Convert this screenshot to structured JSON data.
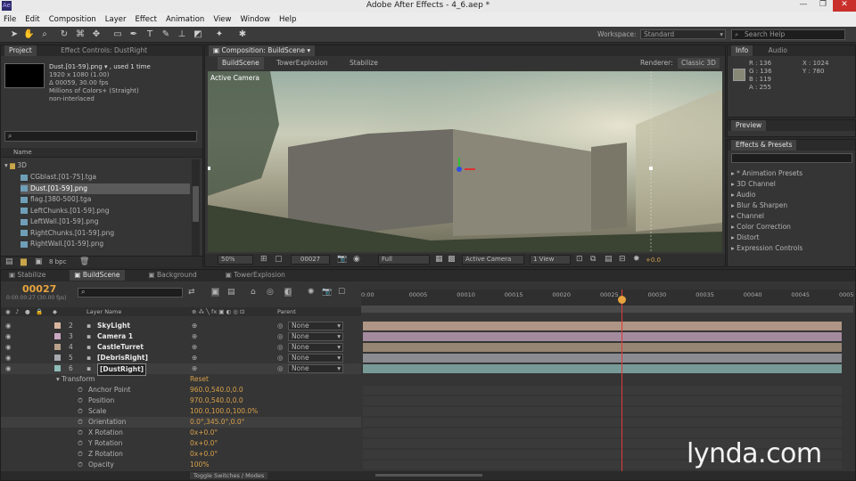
{
  "app": {
    "title": "Adobe After Effects - 4_6.aep *"
  },
  "menu": [
    "File",
    "Edit",
    "Composition",
    "Layer",
    "Effect",
    "Animation",
    "View",
    "Window",
    "Help"
  ],
  "workspace": {
    "label": "Workspace:",
    "value": "Standard"
  },
  "search_help": "Search Help",
  "project": {
    "tabs": [
      "Project",
      "Effect Controls: DustRight"
    ],
    "info_name": "Dust.[01-59].png ▾ , used 1 time",
    "info_lines": [
      "1920 x 1080 (1.00)",
      "Δ 00059, 30.00 fps",
      "Millions of Colors+ (Straight)",
      "non-interlaced"
    ],
    "col_name": "Name",
    "folder": "3D",
    "items": [
      "CGblast.[01-75].tga",
      "Dust.[01-59].png",
      "flag.[380-500].tga",
      "LeftChunks.[01-59].png",
      "LeftWall.[01-59].png",
      "RightChunks.[01-59].png",
      "RightWall.[01-59].png"
    ],
    "bpc": "8 bpc"
  },
  "comp": {
    "tab": "Composition: BuildScene",
    "breadcrumbs": [
      "BuildScene",
      "TowerExplosion",
      "Stabilize"
    ],
    "renderer_label": "Renderer:",
    "renderer": "Classic 3D",
    "camera_label": "Active Camera",
    "zoom": "50%",
    "timecode": "00027",
    "quality": "Full",
    "view_camera": "Active Camera",
    "views": "1 View",
    "exposure": "+0.0"
  },
  "info": {
    "tabs": [
      "Info",
      "Audio"
    ],
    "r": "R : 136",
    "g": "G : 136",
    "b": "B : 119",
    "a": "A : 255",
    "x": "X : 1024",
    "y": "Y : 780"
  },
  "preview": {
    "tab": "Preview"
  },
  "effects": {
    "tab": "Effects & Presets",
    "items": [
      "* Animation Presets",
      "3D Channel",
      "Audio",
      "Blur & Sharpen",
      "Channel",
      "Color Correction",
      "Distort",
      "Expression Controls"
    ]
  },
  "timeline": {
    "tabs": [
      "Stabilize",
      "BuildScene",
      "Background",
      "TowerExplosion"
    ],
    "current_time": "00027",
    "time_sub": "0:00:00:27 (30.00 fps)",
    "col_layer": "Layer Name",
    "col_parent": "Parent",
    "ruler": [
      "0:00",
      "00005",
      "00010",
      "00015",
      "00020",
      "00025",
      "00030",
      "00035",
      "00040",
      "00045",
      "0005"
    ],
    "layers": [
      {
        "num": "2",
        "name": "SkyLight",
        "parent": "None",
        "color": "#d8b5a0"
      },
      {
        "num": "3",
        "name": "Camera 1",
        "parent": "None",
        "color": "#c8a8c0"
      },
      {
        "num": "4",
        "name": "CastleTurret",
        "parent": "None",
        "color": "#b8a28a"
      },
      {
        "num": "5",
        "name": "[DebrisRight]",
        "parent": "None",
        "color": "#a8aab0"
      },
      {
        "num": "6",
        "name": "[DustRight]",
        "parent": "None",
        "color": "#8fbcb8"
      }
    ],
    "transform_label": "Transform",
    "reset": "Reset",
    "props": [
      {
        "name": "Anchor Point",
        "value": "960.0,540.0,0.0"
      },
      {
        "name": "Position",
        "value": "970.0,540.0,0.0"
      },
      {
        "name": "Scale",
        "value": "100.0,100.0,100.0%"
      },
      {
        "name": "Orientation",
        "value": "0.0°,345.0°,0.0°"
      },
      {
        "name": "X Rotation",
        "value": "0x+0.0°"
      },
      {
        "name": "Y Rotation",
        "value": "0x+0.0°"
      },
      {
        "name": "Z Rotation",
        "value": "0x+0.0°"
      },
      {
        "name": "Opacity",
        "value": "100%"
      }
    ],
    "toggle": "Toggle Switches / Modes"
  },
  "watermark": "lynda.com"
}
